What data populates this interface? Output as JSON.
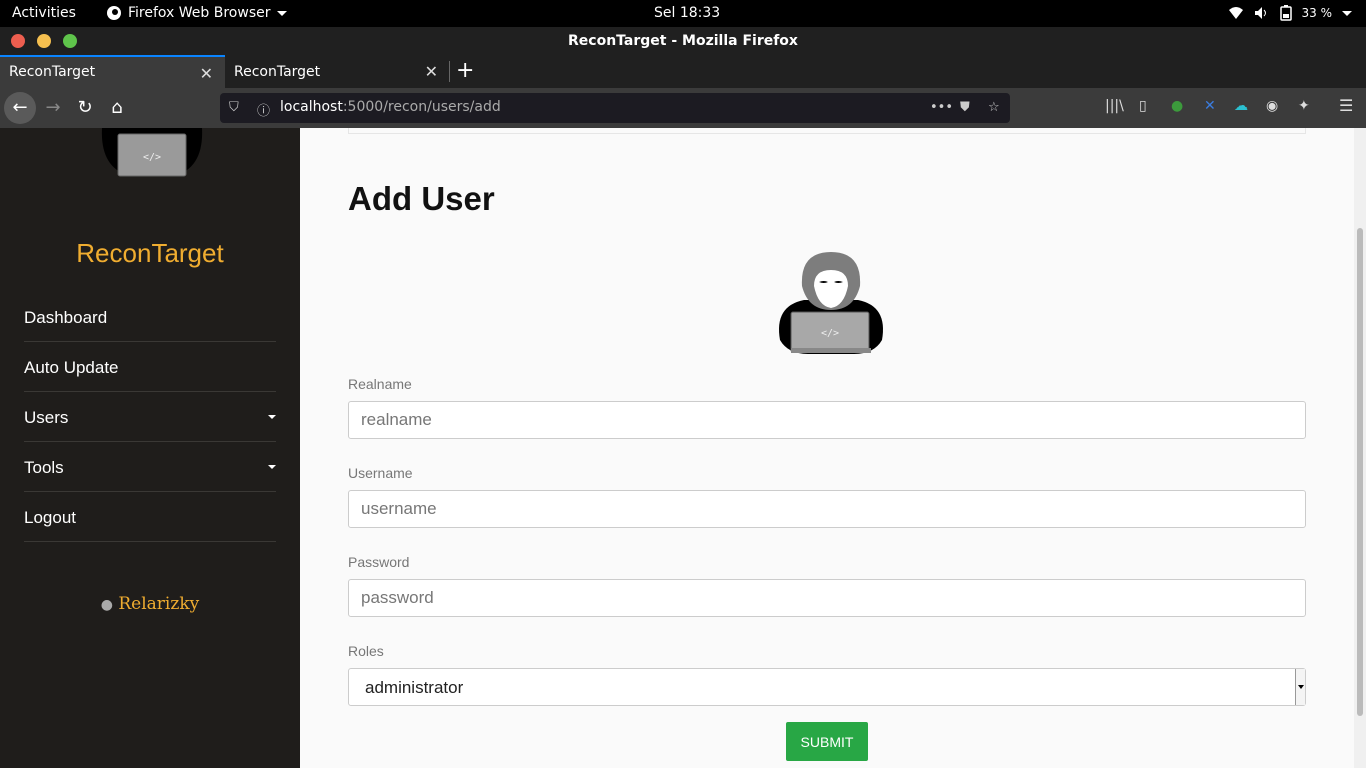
{
  "system": {
    "activities": "Activities",
    "app_name": "Firefox Web Browser",
    "clock": "Sel 18:33",
    "battery": "33 %"
  },
  "window": {
    "title": "ReconTarget - Mozilla Firefox"
  },
  "tabs": [
    {
      "label": "ReconTarget",
      "active": true
    },
    {
      "label": "ReconTarget",
      "active": false
    }
  ],
  "urlbar": {
    "host": "localhost",
    "path": ":5000/recon/users/add"
  },
  "sidebar": {
    "logo_text": "</>",
    "brand": "ReconTarget",
    "items": [
      {
        "label": "Dashboard",
        "dropdown": false
      },
      {
        "label": "Auto Update",
        "dropdown": false
      },
      {
        "label": "Users",
        "dropdown": true
      },
      {
        "label": "Tools",
        "dropdown": true
      },
      {
        "label": "Logout",
        "dropdown": false
      }
    ],
    "credit": "Relarizky"
  },
  "form": {
    "heading": "Add User",
    "hero_text": "</>",
    "realname": {
      "label": "Realname",
      "placeholder": "realname"
    },
    "username": {
      "label": "Username",
      "placeholder": "username"
    },
    "password": {
      "label": "Password",
      "placeholder": "password"
    },
    "roles": {
      "label": "Roles",
      "selected": "administrator"
    },
    "submit": "SUBMIT"
  },
  "colors": {
    "brand": "#f0ad30",
    "submit": "#28a745",
    "accent_tab": "#0a84ff"
  }
}
